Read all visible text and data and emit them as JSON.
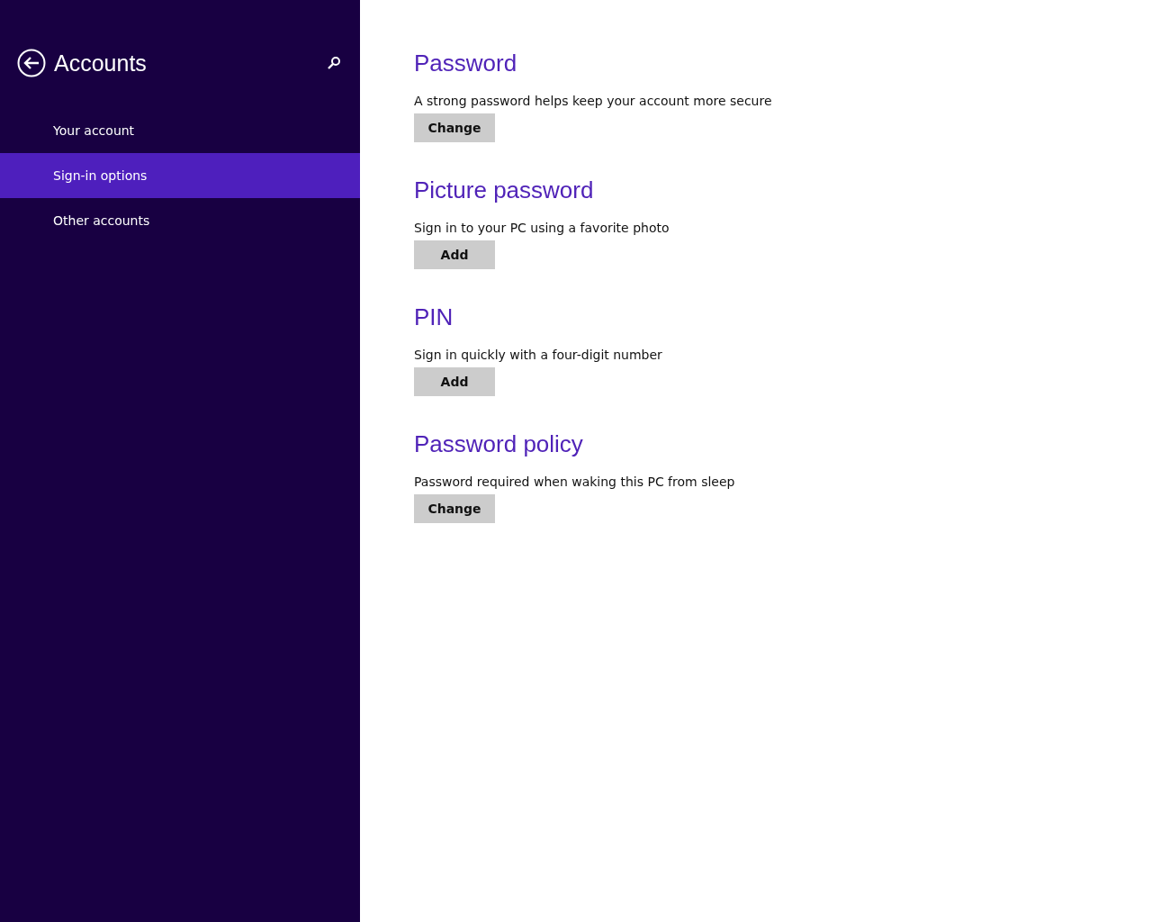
{
  "sidebar": {
    "title": "Accounts",
    "items": [
      {
        "label": "Your account",
        "selected": false
      },
      {
        "label": "Sign-in options",
        "selected": true
      },
      {
        "label": "Other accounts",
        "selected": false
      }
    ]
  },
  "sections": [
    {
      "heading": "Password",
      "description": "A strong password helps keep your account more secure",
      "button": "Change"
    },
    {
      "heading": "Picture password",
      "description": "Sign in to your PC using a favorite photo",
      "button": "Add"
    },
    {
      "heading": "PIN",
      "description": "Sign in quickly with a four-digit number",
      "button": "Add"
    },
    {
      "heading": "Password policy",
      "description": "Password required when waking this PC from sleep",
      "button": "Change"
    }
  ]
}
